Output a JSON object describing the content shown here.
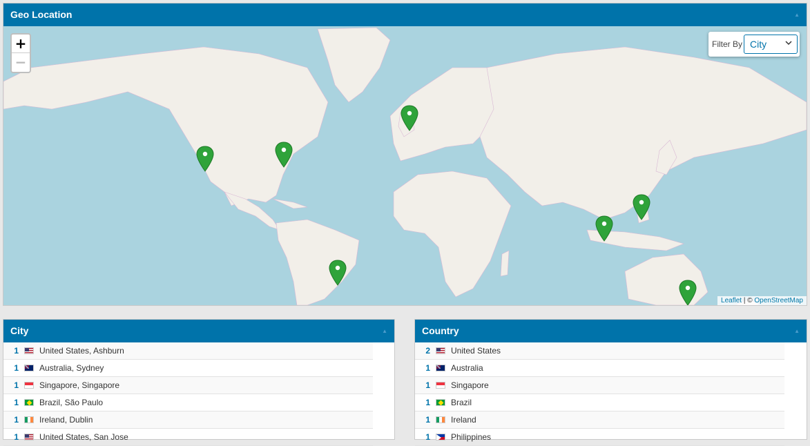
{
  "geo": {
    "title": "Geo Location",
    "collapse": "▲",
    "zoom_in": "+",
    "zoom_out": "−",
    "filter_label": "Filter By",
    "filter_value": "City",
    "attrib_leaflet": "Leaflet",
    "attrib_sep": " | © ",
    "attrib_osm": "OpenStreetMap",
    "pins": [
      "san-jose",
      "ashburn",
      "dublin",
      "sao-paulo",
      "singapore",
      "manila",
      "sydney"
    ]
  },
  "city": {
    "title": "City",
    "collapse": "▲",
    "rows": [
      {
        "count": "1",
        "flag": "us",
        "label": "United States, Ashburn"
      },
      {
        "count": "1",
        "flag": "au",
        "label": "Australia, Sydney"
      },
      {
        "count": "1",
        "flag": "sg",
        "label": "Singapore, Singapore"
      },
      {
        "count": "1",
        "flag": "br",
        "label": "Brazil, São Paulo"
      },
      {
        "count": "1",
        "flag": "ie",
        "label": "Ireland, Dublin"
      },
      {
        "count": "1",
        "flag": "us",
        "label": "United States, San Jose"
      }
    ]
  },
  "country": {
    "title": "Country",
    "collapse": "▲",
    "rows": [
      {
        "count": "2",
        "flag": "us",
        "label": "United States"
      },
      {
        "count": "1",
        "flag": "au",
        "label": "Australia"
      },
      {
        "count": "1",
        "flag": "sg",
        "label": "Singapore"
      },
      {
        "count": "1",
        "flag": "br",
        "label": "Brazil"
      },
      {
        "count": "1",
        "flag": "ie",
        "label": "Ireland"
      },
      {
        "count": "1",
        "flag": "ph",
        "label": "Philippines"
      }
    ]
  },
  "colors": {
    "header": "#0073aa",
    "water": "#aad3df",
    "land": "#f2efe9",
    "pin": "#2fa33a"
  }
}
